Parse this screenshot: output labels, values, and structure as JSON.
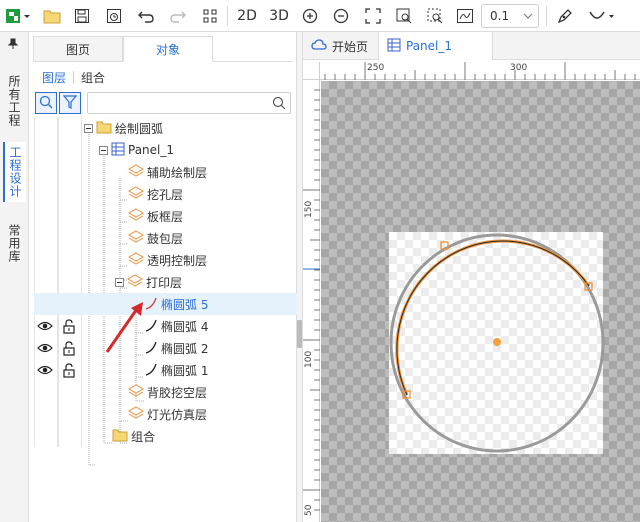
{
  "toolbar": {
    "view_2d": "2D",
    "view_3d": "3D",
    "line_width": "0.1",
    "icons": [
      "new-project-icon",
      "open-folder-icon",
      "save-icon",
      "save-as-icon",
      "undo-icon",
      "redo-icon",
      "grid-icon",
      "zoom-in-icon",
      "zoom-out-icon",
      "fit-icon",
      "zoom-window-icon",
      "zoom-select-icon",
      "measure-icon",
      "pen-icon",
      "arc-tool-icon"
    ]
  },
  "side_tabs": {
    "all_projects": "所有工程",
    "project_design": "工程设计",
    "library": "常用库"
  },
  "panel": {
    "tabs": [
      "图页",
      "对象"
    ],
    "subtabs": [
      "图层",
      "组合"
    ],
    "search": {
      "value": "",
      "placeholder": ""
    }
  },
  "tree": {
    "root": "绘制圆弧",
    "panel": "Panel_1",
    "layers": [
      "辅助绘制层",
      "挖孔层",
      "板框层",
      "鼓包层",
      "透明控制层",
      "打印层"
    ],
    "print_items": [
      "椭圆弧 5",
      "椭圆弧 4",
      "椭圆弧 2",
      "椭圆弧 1"
    ],
    "after_layers": [
      "背胶挖空层",
      "灯光仿真层"
    ],
    "group": "组合"
  },
  "doc_tabs": {
    "start": "开始页",
    "panel": "Panel_1"
  },
  "rulers": {
    "h": [
      "250",
      "300"
    ],
    "v": [
      "150",
      "100",
      "50"
    ]
  },
  "colors": {
    "accent": "#2b6fd6",
    "arc_selected": "#e8913a",
    "arc_default": "#9a9a9a"
  }
}
